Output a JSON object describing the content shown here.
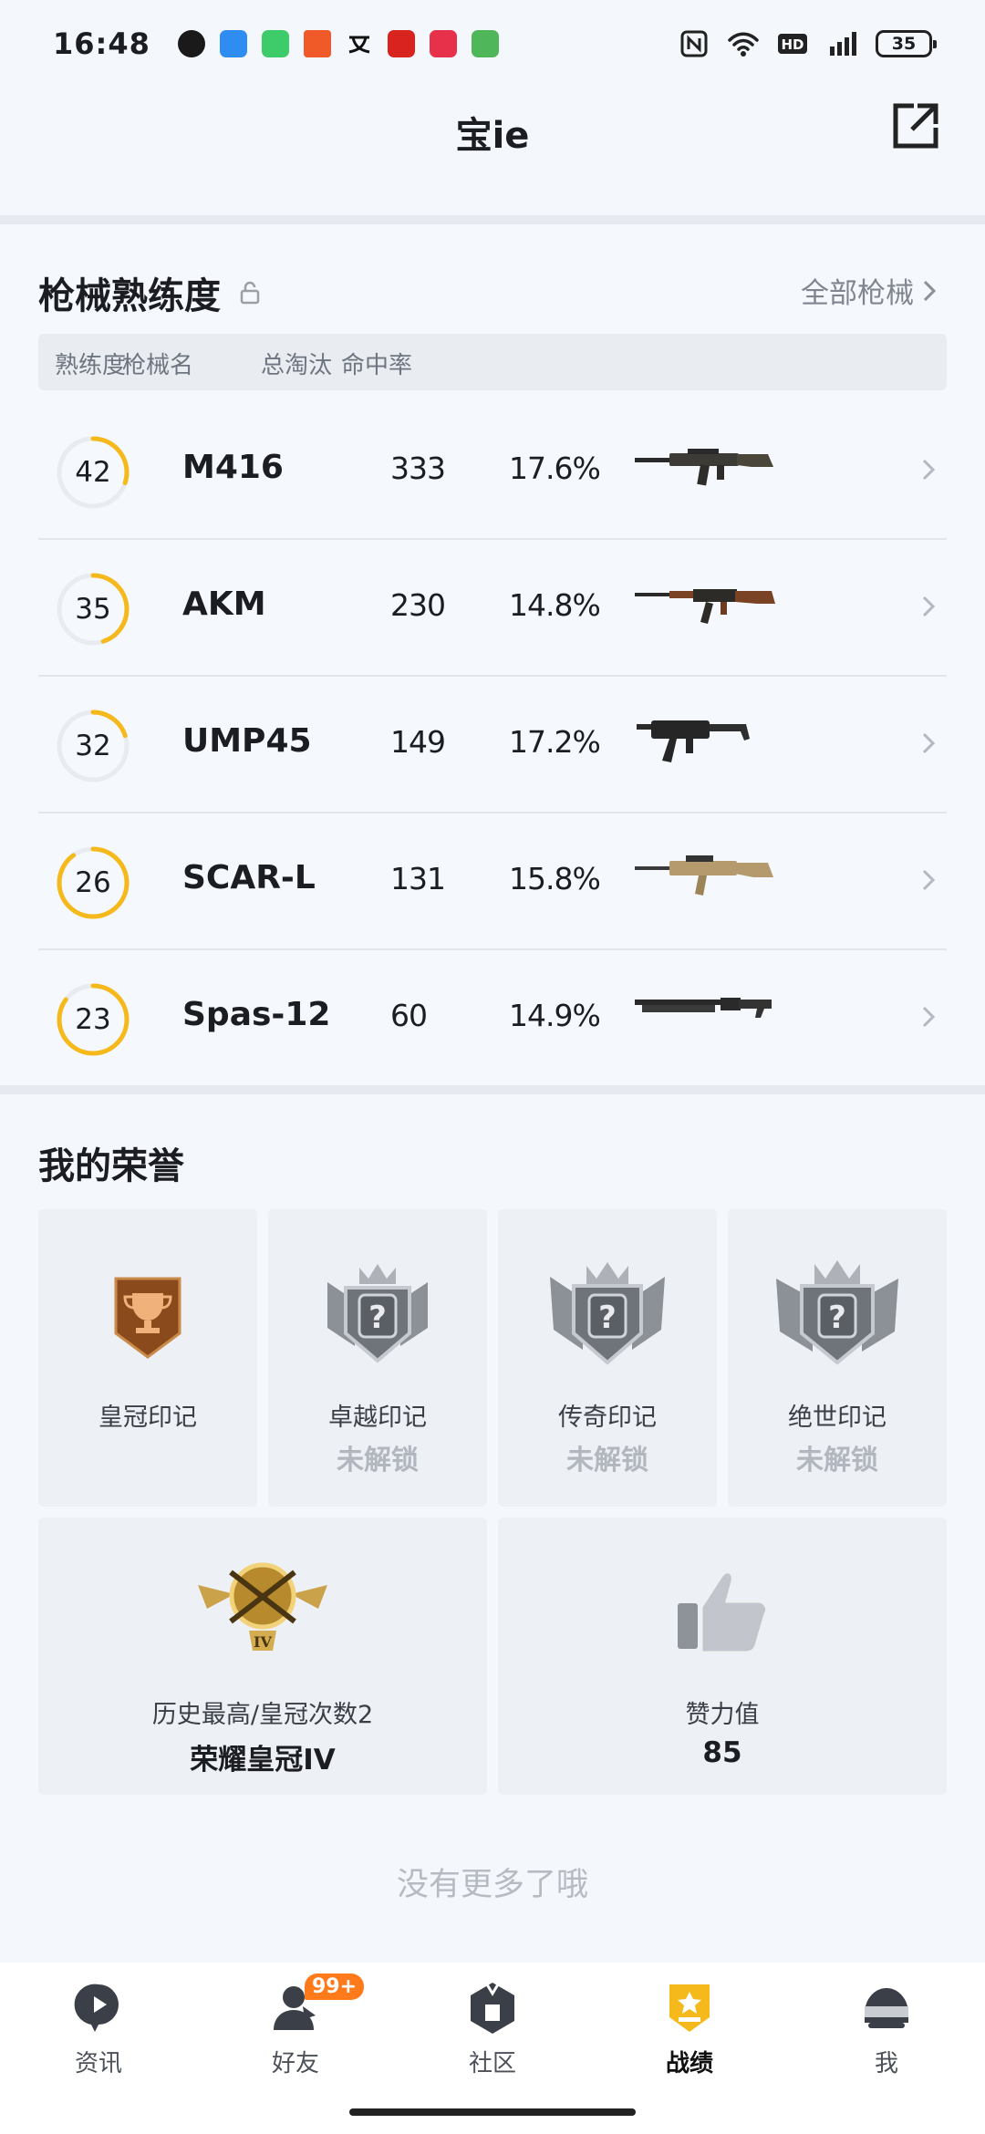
{
  "status_bar": {
    "time": "16:48",
    "battery": "35"
  },
  "header": {
    "title": "宝ie"
  },
  "weapons": {
    "section_title": "枪械熟练度",
    "all_link": "全部枪械",
    "columns": [
      "熟练度",
      "枪械名",
      "总淘汰",
      "命中率"
    ],
    "rows": [
      {
        "level": "42",
        "progress": 0.3,
        "name": "M416",
        "kills": "333",
        "rate": "17.6%"
      },
      {
        "level": "35",
        "progress": 0.45,
        "name": "AKM",
        "kills": "230",
        "rate": "14.8%"
      },
      {
        "level": "32",
        "progress": 0.2,
        "name": "UMP45",
        "kills": "149",
        "rate": "17.2%"
      },
      {
        "level": "26",
        "progress": 0.9,
        "name": "SCAR-L",
        "kills": "131",
        "rate": "15.8%"
      },
      {
        "level": "23",
        "progress": 0.85,
        "name": "Spas-12",
        "kills": "60",
        "rate": "14.9%"
      }
    ]
  },
  "honors": {
    "section_title": "我的荣誉",
    "marks": [
      {
        "label": "皇冠印记",
        "status": ""
      },
      {
        "label": "卓越印记",
        "status": "未解锁"
      },
      {
        "label": "传奇印记",
        "status": "未解锁"
      },
      {
        "label": "绝世印记",
        "status": "未解锁"
      }
    ],
    "rank": {
      "label": "历史最高/皇冠次数2",
      "value": "荣耀皇冠IV"
    },
    "likes": {
      "label": "赞力值",
      "value": "85"
    },
    "no_more": "没有更多了哦"
  },
  "nav": {
    "items": [
      {
        "label": "资讯"
      },
      {
        "label": "好友",
        "badge": "99+"
      },
      {
        "label": "社区"
      },
      {
        "label": "战绩"
      },
      {
        "label": "我"
      }
    ]
  },
  "colors": {
    "accent": "#f6b91b",
    "ring_track": "#e8ebef",
    "muted": "#b2b7bf"
  }
}
